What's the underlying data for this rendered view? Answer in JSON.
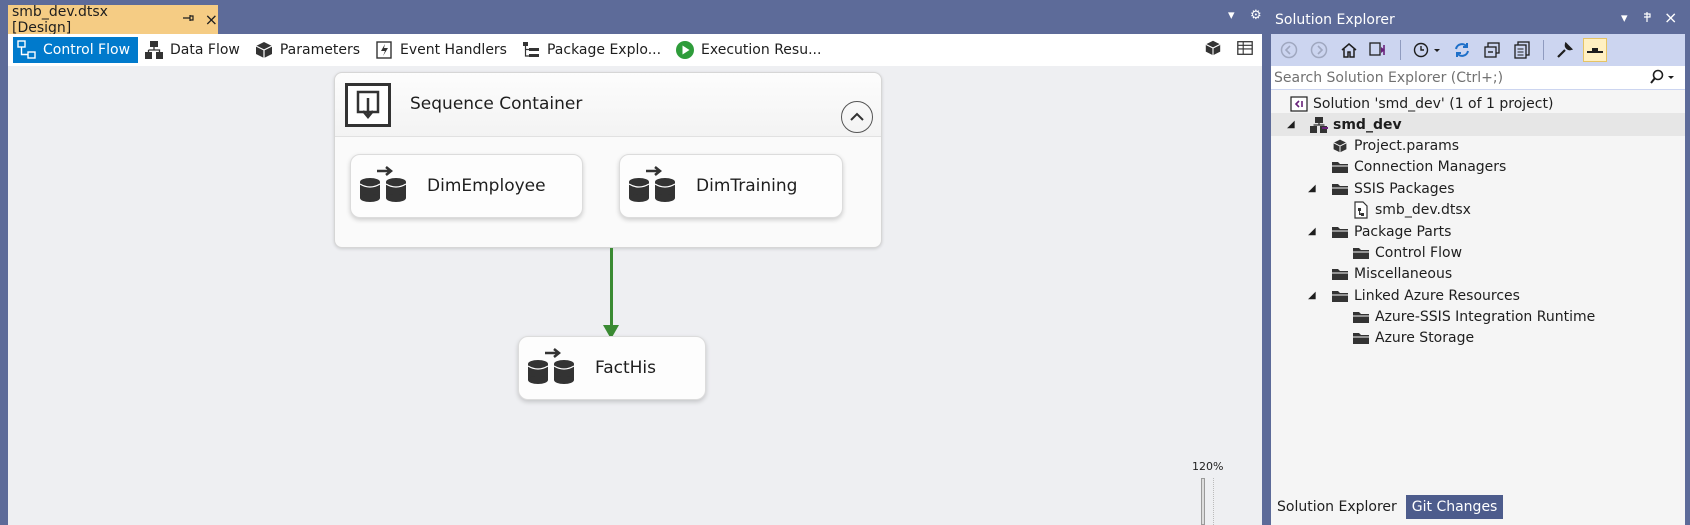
{
  "document_tab": {
    "title": "smb_dev.dtsx [Design]",
    "pin_icon": "pin-icon",
    "close_label": "×"
  },
  "designer_tabs": [
    {
      "label": "Control Flow",
      "icon": "control-flow-icon",
      "active": true
    },
    {
      "label": "Data Flow",
      "icon": "data-flow-icon",
      "active": false
    },
    {
      "label": "Parameters",
      "icon": "parameters-icon",
      "active": false
    },
    {
      "label": "Event Handlers",
      "icon": "event-handlers-icon",
      "active": false
    },
    {
      "label": "Package Explo...",
      "icon": "package-explorer-icon",
      "active": false
    },
    {
      "label": "Execution Resu...",
      "icon": "execution-results-icon",
      "active": false
    }
  ],
  "canvas": {
    "sequence_container": {
      "title": "Sequence Container",
      "tasks": [
        "DimEmployee",
        "DimTraining"
      ]
    },
    "downstream_task": "FactHis",
    "precedence_color": "#3a8a33",
    "zoom": "120%"
  },
  "solution_explorer": {
    "title": "Solution Explorer",
    "search_placeholder": "Search Solution Explorer (Ctrl+;)",
    "tree": {
      "solution": "Solution 'smd_dev' (1 of 1 project)",
      "project": "smd_dev",
      "items": {
        "project_params": "Project.params",
        "connection_managers": "Connection Managers",
        "ssis_packages": "SSIS Packages",
        "package_file": "smb_dev.dtsx",
        "package_parts": "Package Parts",
        "control_flow": "Control Flow",
        "miscellaneous": "Miscellaneous",
        "linked_azure": "Linked Azure Resources",
        "azure_ssis_ir": "Azure-SSIS Integration Runtime",
        "azure_storage": "Azure Storage"
      }
    },
    "bottom_tabs": [
      "Solution Explorer",
      "Git Changes"
    ]
  },
  "colors": {
    "accent": "#007acc",
    "chrome": "#5d6b99",
    "document_tab": "#f5cc84",
    "toolbar": "#ccd5f0"
  }
}
